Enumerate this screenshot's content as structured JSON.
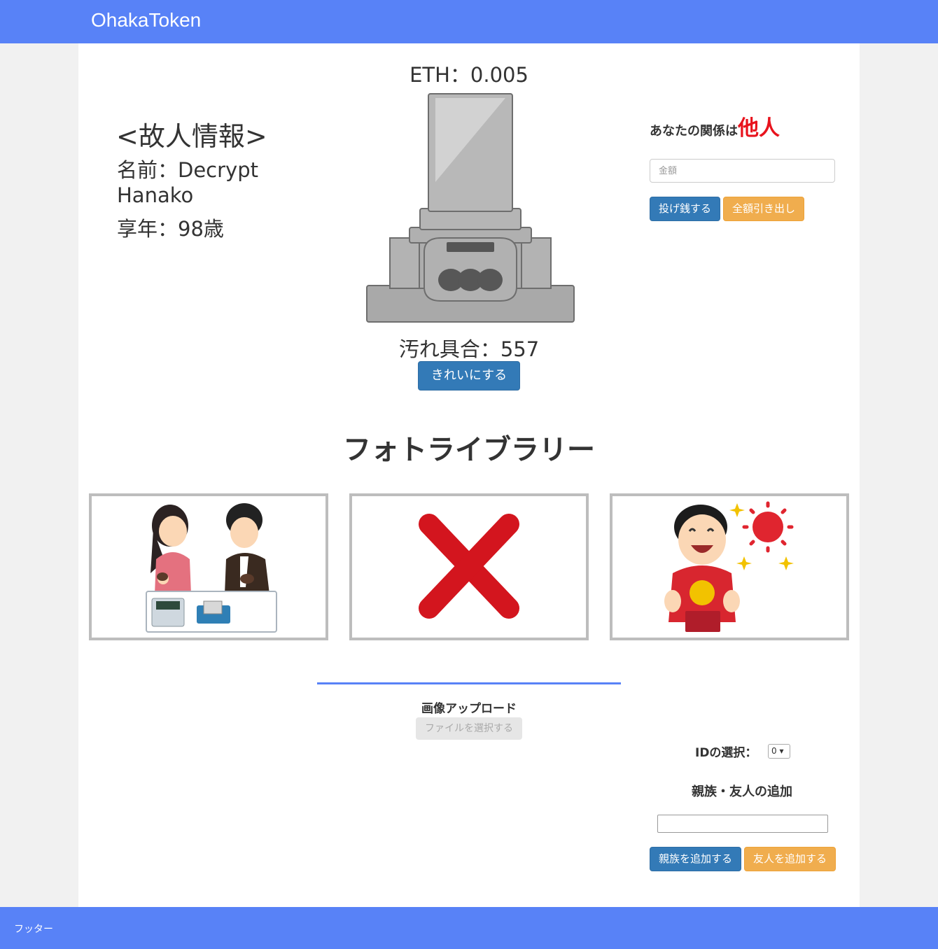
{
  "navbar": {
    "brand": "OhakaToken"
  },
  "deceased": {
    "heading": "<故人情報>",
    "name_line1": "名前：Decrypt",
    "name_line2": "Hanako",
    "age_line": "享年：98歳"
  },
  "grave": {
    "eth": "ETH：0.005",
    "dirtiness": "汚れ具合：557",
    "clean_button": "きれいにする"
  },
  "relation": {
    "prefix": "あなたの関係は",
    "value": "他人",
    "value_color": "#e8131d"
  },
  "donation": {
    "amount_placeholder": "金額",
    "donate_button": "投げ銭する",
    "withdraw_button": "全額引き出し"
  },
  "photo_library": {
    "title": "フォトライブラリー",
    "photos": [
      {
        "icon": "couple-at-register-illustration"
      },
      {
        "icon": "red-x-mark-illustration"
      },
      {
        "icon": "happy-boy-with-sun-illustration"
      }
    ]
  },
  "upload": {
    "label": "画像アップロード",
    "file_button": "ファイルを選択する"
  },
  "id_select": {
    "label": "IDの選択：",
    "selected": "0 ▾"
  },
  "add_member": {
    "label": "親族・友人の追加",
    "add_relative_button": "親族を追加する",
    "add_friend_button": "友人を追加する"
  },
  "footer": {
    "text": "フッター"
  },
  "colors": {
    "accent": "#5882f7",
    "primary_button": "#337ab7",
    "warning_button": "#f0ad4e"
  }
}
